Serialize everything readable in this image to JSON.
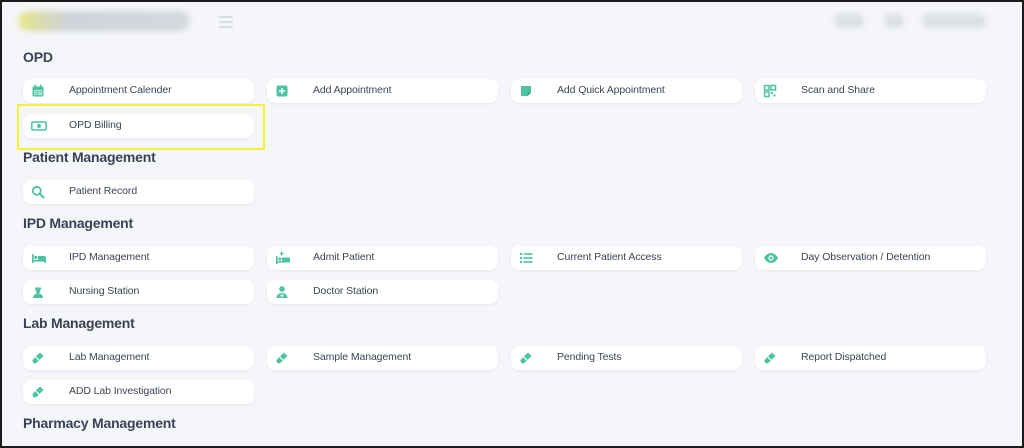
{
  "colors": {
    "accent": "#4cc3a2",
    "highlight": "#f2f23a",
    "text": "#3c4656"
  },
  "sections": {
    "opd": {
      "title": "OPD",
      "items": [
        {
          "label": "Appointment Calender",
          "icon": "calendar-icon"
        },
        {
          "label": "Add Appointment",
          "icon": "plus-square-icon"
        },
        {
          "label": "Add Quick Appointment",
          "icon": "note-icon"
        },
        {
          "label": "Scan and Share",
          "icon": "qr-code-icon"
        },
        {
          "label": "OPD Billing",
          "icon": "money-bill-icon"
        }
      ]
    },
    "patient": {
      "title": "Patient Management",
      "items": [
        {
          "label": "Patient Record",
          "icon": "search-icon"
        }
      ]
    },
    "ipd": {
      "title": "IPD Management",
      "items": [
        {
          "label": "IPD Management",
          "icon": "bed-icon"
        },
        {
          "label": "Admit Patient",
          "icon": "hospital-bed-icon"
        },
        {
          "label": "Current Patient Access",
          "icon": "list-icon"
        },
        {
          "label": "Day Observation / Detention",
          "icon": "eye-icon"
        },
        {
          "label": "Nursing Station",
          "icon": "nurse-icon"
        },
        {
          "label": "Doctor Station",
          "icon": "doctor-icon"
        }
      ]
    },
    "lab": {
      "title": "Lab Management",
      "items": [
        {
          "label": "Lab Management",
          "icon": "test-tube-icon"
        },
        {
          "label": "Sample Management",
          "icon": "test-tube-icon"
        },
        {
          "label": "Pending Tests",
          "icon": "test-tube-icon"
        },
        {
          "label": "Report Dispatched",
          "icon": "test-tube-icon"
        },
        {
          "label": "ADD Lab Investigation",
          "icon": "test-tube-icon"
        }
      ]
    },
    "pharmacy": {
      "title": "Pharmacy Management"
    }
  }
}
